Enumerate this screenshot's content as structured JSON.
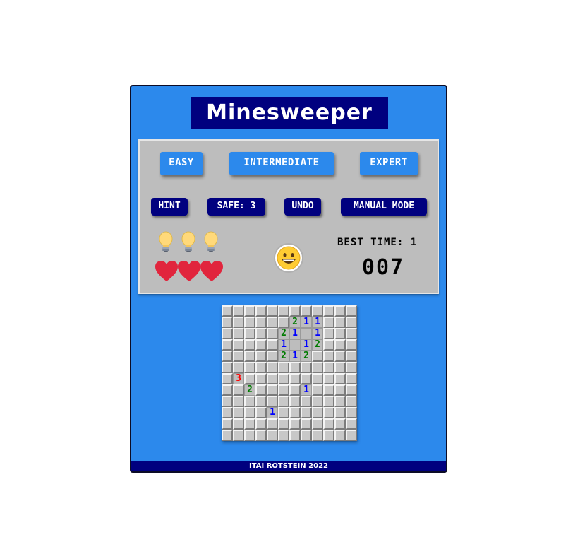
{
  "title": "Minesweeper",
  "levels": [
    {
      "label": "EASY"
    },
    {
      "label": "INTERMEDIATE"
    },
    {
      "label": "EXPERT"
    }
  ],
  "tools": {
    "hint": "HINT",
    "safe": "SAFE: 3",
    "undo": "UNDO",
    "manual": "MANUAL MODE"
  },
  "hints_remaining": 3,
  "lives_remaining": 3,
  "best_time": "BEST TIME: 1",
  "timer": "007",
  "smiley": "grinning-face",
  "board": {
    "rows": 12,
    "cols": 12,
    "cells": [
      "############",
      "######211###",
      "#####21 1###",
      "#####1 12###",
      "#####212####",
      "############",
      "#3##########",
      "##2####1####",
      "############",
      "####1#######",
      "############",
      "############"
    ]
  },
  "footer": "ITAI ROTSTEIN 2022",
  "colors": {
    "frame": "#2c89ec",
    "navy": "#00007f",
    "panel": "#bdbdbd",
    "num1": "#0000ff",
    "num2": "#007b00",
    "num3": "#ff0000",
    "heart": "#e1253d"
  }
}
